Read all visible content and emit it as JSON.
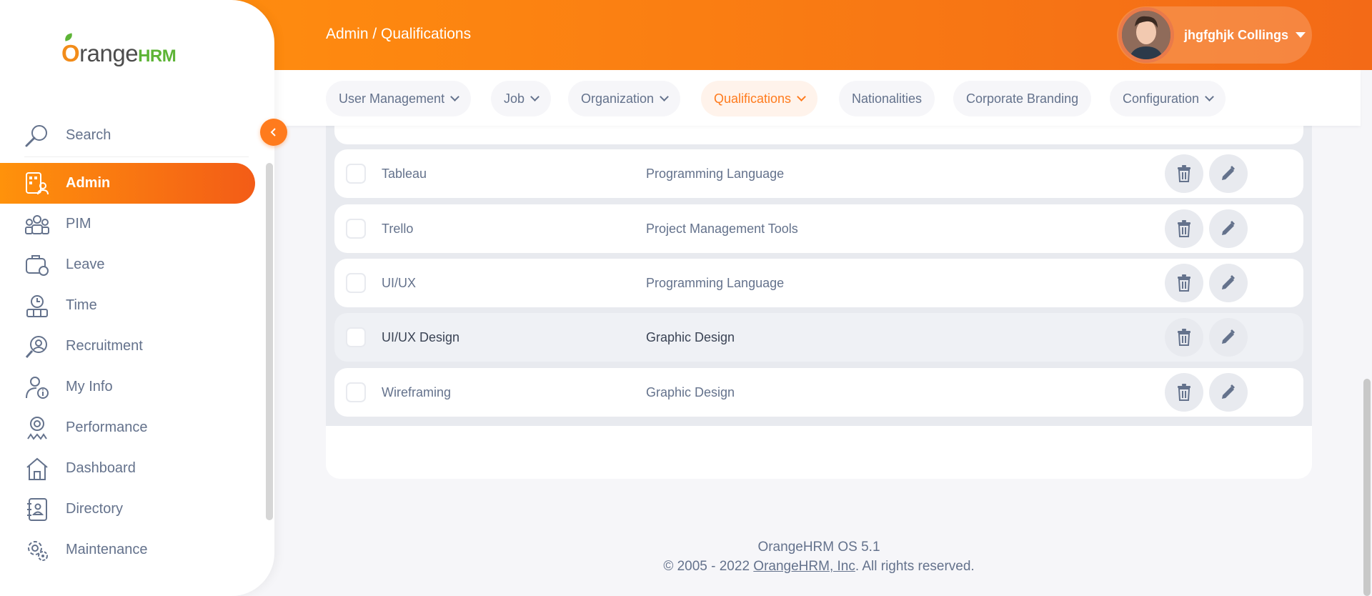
{
  "app": {
    "logo_text_o": "O",
    "logo_text_range": "range",
    "logo_text_hrm": "HRM"
  },
  "header": {
    "breadcrumb": "Admin / Qualifications",
    "user_name": "jhgfghjk Collings"
  },
  "sidebar": {
    "search_label": "Search",
    "items": [
      {
        "label": "Admin",
        "icon": "admin-icon",
        "active": true
      },
      {
        "label": "PIM",
        "icon": "pim-icon"
      },
      {
        "label": "Leave",
        "icon": "leave-icon"
      },
      {
        "label": "Time",
        "icon": "time-icon"
      },
      {
        "label": "Recruitment",
        "icon": "recruitment-icon"
      },
      {
        "label": "My Info",
        "icon": "my-info-icon"
      },
      {
        "label": "Performance",
        "icon": "performance-icon"
      },
      {
        "label": "Dashboard",
        "icon": "dashboard-icon"
      },
      {
        "label": "Directory",
        "icon": "directory-icon"
      },
      {
        "label": "Maintenance",
        "icon": "maintenance-icon"
      }
    ]
  },
  "subnav": {
    "tabs": [
      {
        "label": "User Management",
        "dropdown": true
      },
      {
        "label": "Job",
        "dropdown": true
      },
      {
        "label": "Organization",
        "dropdown": true
      },
      {
        "label": "Qualifications",
        "dropdown": true,
        "active": true
      },
      {
        "label": "Nationalities",
        "dropdown": false
      },
      {
        "label": "Corporate Branding",
        "dropdown": false
      },
      {
        "label": "Configuration",
        "dropdown": true
      }
    ]
  },
  "table": {
    "rows": [
      {
        "name": "Tableau",
        "category": "Programming Language"
      },
      {
        "name": "Trello",
        "category": "Project Management Tools"
      },
      {
        "name": "UI/UX",
        "category": "Programming Language"
      },
      {
        "name": "UI/UX Design",
        "category": "Graphic Design"
      },
      {
        "name": "Wireframing",
        "category": "Graphic Design"
      }
    ]
  },
  "footer": {
    "version": "OrangeHRM OS 5.1",
    "copyright_prefix": "© 2005 - 2022 ",
    "company_link": "OrangeHRM, Inc",
    "copyright_suffix": ". All rights reserved."
  },
  "colors": {
    "accent": "#ff7b1d",
    "brand_green": "#5db436",
    "text": "#64728c"
  }
}
